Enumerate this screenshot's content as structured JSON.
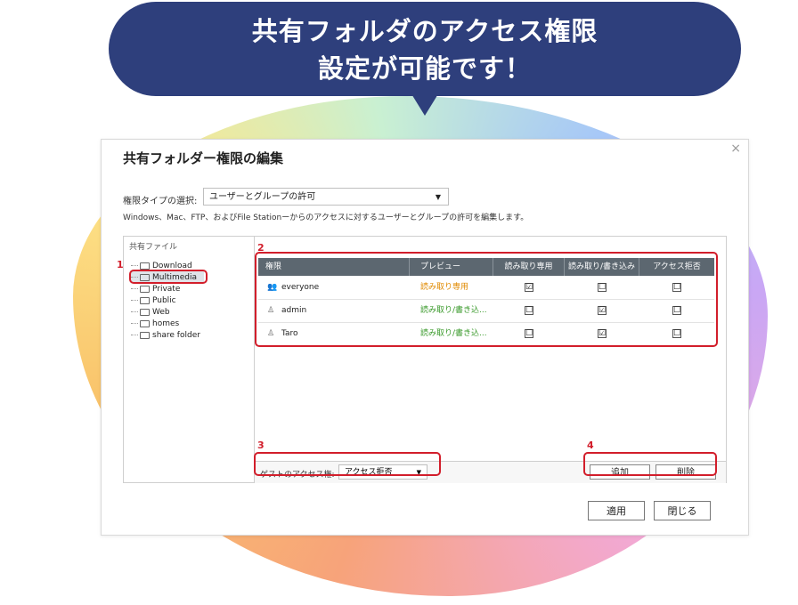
{
  "banner": {
    "headline": "共有フォルダのアクセス権限\n設定が可能です！"
  },
  "dialog": {
    "title": "共有フォルダー権限の編集",
    "close_icon": "close-icon",
    "perm_type_label": "権限タイプの選択:",
    "perm_type_value": "ユーザーとグループの許可",
    "description": "Windows、Mac、FTP、およびFile Stationーからのアクセスに対するユーザーとグループの許可を編集します。",
    "tree": {
      "header": "共有ファイル",
      "items": [
        "Download",
        "Multimedia",
        "Private",
        "Public",
        "Web",
        "homes",
        "share folder"
      ],
      "selected": "Multimedia"
    },
    "table": {
      "columns": [
        "権限",
        "プレビュー",
        "読み取り専用",
        "読み取り/書き込み",
        "アクセス拒否"
      ],
      "rows": [
        {
          "name": "everyone",
          "icon": "group-icon",
          "preview": "読み取り専用",
          "preview_color": "#e08a00",
          "read_only": "☑",
          "read_write": "☐",
          "deny": "☐"
        },
        {
          "name": "admin",
          "icon": "user-icon",
          "preview": "読み取り/書き込...",
          "preview_color": "#3a9a2b",
          "read_only": "☐",
          "read_write": "☑",
          "deny": "☐"
        },
        {
          "name": "Taro",
          "icon": "user-icon",
          "preview": "読み取り/書き込...",
          "preview_color": "#3a9a2b",
          "read_only": "☐",
          "read_write": "☑",
          "deny": "☐"
        }
      ]
    },
    "guest_access_label": "ゲストのアクセス権:",
    "guest_access_value": "アクセス拒否",
    "add_label": "追加",
    "delete_label": "削除",
    "apply_label": "適用",
    "close_label": "閉じる"
  },
  "annotations": {
    "n1": "1",
    "n2": "2",
    "n3": "3",
    "n4": "4",
    "color": "#d21e2b"
  },
  "colors": {
    "bubble": "#2e3f7c",
    "table_header": "#5c6770"
  }
}
